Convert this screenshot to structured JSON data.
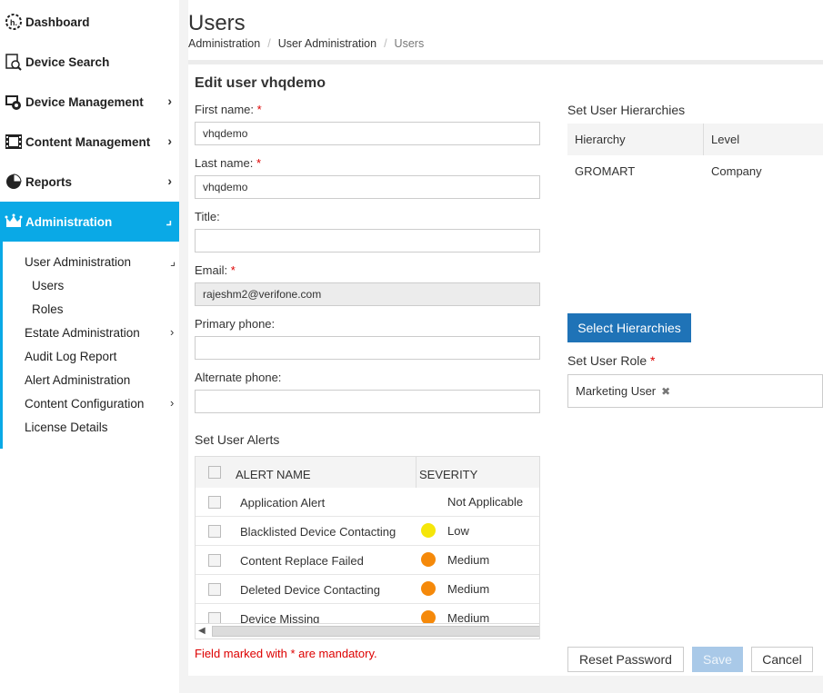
{
  "sidebar": {
    "items": [
      {
        "label": "Dashboard",
        "icon": "dashboard-icon"
      },
      {
        "label": "Device Search",
        "icon": "device-search-icon"
      },
      {
        "label": "Device Management",
        "icon": "device-management-icon"
      },
      {
        "label": "Content Management",
        "icon": "content-management-icon"
      },
      {
        "label": "Reports",
        "icon": "pie-chart-icon"
      },
      {
        "label": "Administration",
        "icon": "crown-icon",
        "active": true
      }
    ],
    "sub_items": [
      {
        "label": "User Administration"
      },
      {
        "label": "Users"
      },
      {
        "label": "Roles"
      },
      {
        "label": "Estate Administration"
      },
      {
        "label": "Audit Log Report"
      },
      {
        "label": "Alert Administration"
      },
      {
        "label": "Content Configuration"
      },
      {
        "label": "License Details"
      }
    ],
    "accent_color": "#0aa9e6"
  },
  "header": {
    "title": "Users",
    "breadcrumb": [
      "Administration",
      "User Administration",
      "Users"
    ]
  },
  "form": {
    "title": "Edit user vhqdemo",
    "first_name": {
      "label": "First name:",
      "value": "vhqdemo"
    },
    "last_name": {
      "label": "Last name:",
      "value": "vhqdemo"
    },
    "title_field": {
      "label": "Title:",
      "value": ""
    },
    "email": {
      "label": "Email:",
      "value": "rajeshm2@verifone.com"
    },
    "primary_phone": {
      "label": "Primary phone:",
      "value": ""
    },
    "alternate_phone": {
      "label": "Alternate phone:",
      "value": ""
    },
    "required_marker": "*"
  },
  "hierarchies": {
    "heading": "Set User Hierarchies",
    "columns": [
      "Hierarchy",
      "Level"
    ],
    "rows": [
      {
        "hierarchy": "GROMART",
        "level": "Company"
      }
    ],
    "select_button": "Select Hierarchies"
  },
  "role": {
    "heading": "Set User Role",
    "selected": "Marketing User",
    "remove_glyph": "✖"
  },
  "alerts": {
    "heading": "Set User Alerts",
    "columns": [
      "ALERT NAME",
      "SEVERITY"
    ],
    "rows": [
      {
        "name": "Application Alert",
        "severity": "Not Applicable",
        "color": ""
      },
      {
        "name": "Blacklisted Device Contacting",
        "severity": "Low",
        "color": "#f5e60a"
      },
      {
        "name": "Content Replace Failed",
        "severity": "Medium",
        "color": "#f5890a"
      },
      {
        "name": "Deleted Device Contacting",
        "severity": "Medium",
        "color": "#f5890a"
      },
      {
        "name": "Device Missing",
        "severity": "Medium",
        "color": "#f5890a"
      }
    ]
  },
  "footer": {
    "mandatory_note": "Field marked with * are mandatory.",
    "reset_password": "Reset Password",
    "save": "Save",
    "cancel": "Cancel"
  }
}
